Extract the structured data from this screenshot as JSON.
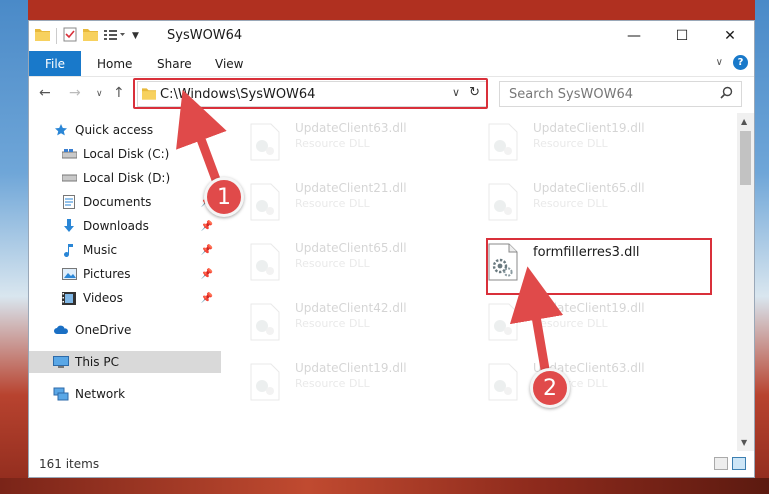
{
  "window": {
    "title": "SysWOW64",
    "controls": {
      "minimize": "—",
      "maximize": "☐",
      "close": "✕"
    }
  },
  "ribbon": {
    "tabs": [
      {
        "label": "File"
      },
      {
        "label": "Home"
      },
      {
        "label": "Share"
      },
      {
        "label": "View"
      }
    ],
    "help_label": "?"
  },
  "navigation": {
    "address_path": "C:\\Windows\\SysWOW64",
    "search_placeholder": "Search SysWOW64"
  },
  "sidebar": {
    "items": [
      {
        "label": "Quick access",
        "icon": "star-icon"
      },
      {
        "label": "Local Disk (C:)",
        "icon": "drive-icon"
      },
      {
        "label": "Local Disk (D:)",
        "icon": "drive-icon"
      },
      {
        "label": "Documents",
        "icon": "document-icon"
      },
      {
        "label": "Downloads",
        "icon": "download-icon"
      },
      {
        "label": "Music",
        "icon": "music-icon"
      },
      {
        "label": "Pictures",
        "icon": "picture-icon"
      },
      {
        "label": "Videos",
        "icon": "video-icon"
      },
      {
        "label": "OneDrive",
        "icon": "cloud-icon"
      },
      {
        "label": "This PC",
        "icon": "computer-icon"
      },
      {
        "label": "Network",
        "icon": "network-icon"
      }
    ]
  },
  "files": [
    {
      "name": "UpdateClient63.dll",
      "type": "Resource DLL"
    },
    {
      "name": "UpdateClient19.dll",
      "type": "Resource DLL"
    },
    {
      "name": "UpdateClient21.dll",
      "type": "Resource DLL"
    },
    {
      "name": "UpdateClient65.dll",
      "type": "Resource DLL"
    },
    {
      "name": "UpdateClient65.dll",
      "type": "Resource DLL"
    },
    {
      "name": "formfillerres3.dll",
      "type": ""
    },
    {
      "name": "UpdateClient42.dll",
      "type": "Resource DLL"
    },
    {
      "name": "UpdateClient19.dll",
      "type": "Resource DLL"
    },
    {
      "name": "UpdateClient19.dll",
      "type": "Resource DLL"
    },
    {
      "name": "UpdateClient63.dll",
      "type": "Resource DLL"
    }
  ],
  "status": {
    "item_count": "161 items"
  },
  "annotations": {
    "step1": "1",
    "step2": "2"
  },
  "colors": {
    "accent": "#1979ca",
    "highlight": "#d9303a",
    "badge": "#e04a4a"
  }
}
